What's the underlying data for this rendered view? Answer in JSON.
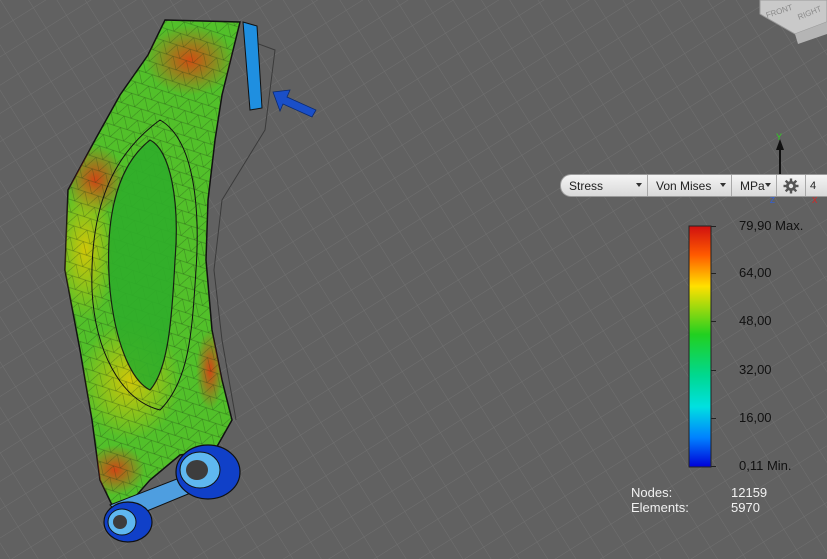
{
  "view_cube": {
    "front_label": "FRONT",
    "right_label": "RIGHT"
  },
  "triad": {
    "y_label": "Y",
    "z_label": "Z",
    "x_label": "X"
  },
  "toolbar": {
    "result_type": "Stress",
    "component": "Von Mises",
    "units": "MPa",
    "settings_icon": "gear-icon",
    "more_label": "4"
  },
  "legend": {
    "max_label": "79,90 Max.",
    "label_64": "64,00",
    "label_48": "48,00",
    "label_32": "32,00",
    "label_16": "16,00",
    "min_label": "0,11 Min.",
    "colors": [
      "#d01010",
      "#ff6a00",
      "#ffe000",
      "#00cc20",
      "#00e0e0",
      "#0070ff",
      "#0000e0"
    ]
  },
  "mesh_info": {
    "nodes_label": "Nodes:",
    "nodes_value": "12159",
    "elements_label": "Elements:",
    "elements_value": "5970"
  },
  "load_arrow": {
    "icon": "load-arrow-icon",
    "color": "#1a4fc8"
  }
}
